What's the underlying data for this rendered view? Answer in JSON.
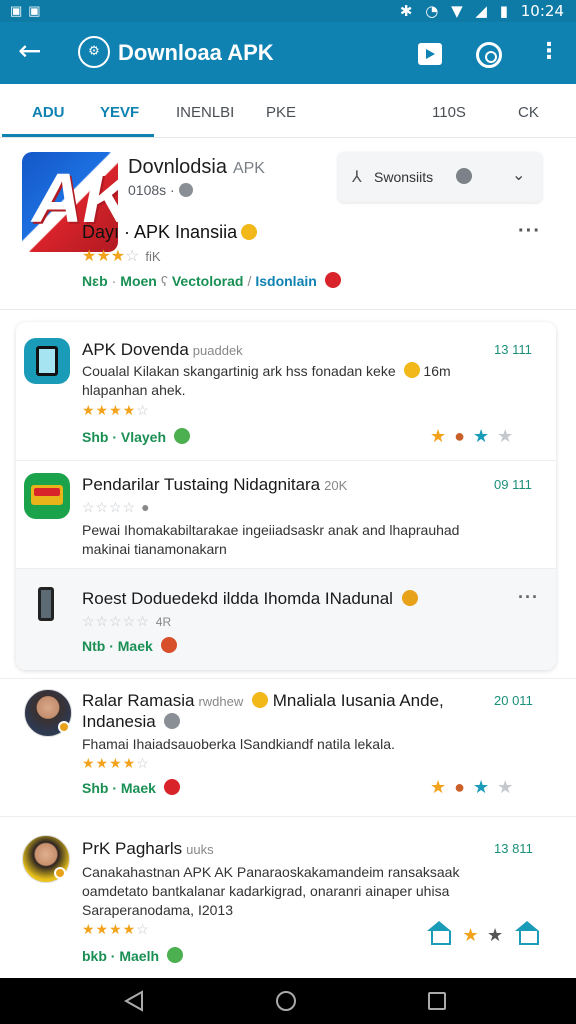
{
  "status_bar": {
    "time": "10:24"
  },
  "app_bar": {
    "title": "Downloaa APK"
  },
  "tabs": [
    {
      "label": "ADU",
      "active": true
    },
    {
      "label": "YEVF",
      "active": true
    },
    {
      "label": "INENLBI",
      "active": false
    },
    {
      "label": "PKE",
      "active": false
    },
    {
      "label": "110S",
      "active": false
    },
    {
      "label": "CK",
      "active": false
    }
  ],
  "header": {
    "title": "Dovnlodsia",
    "title_suffix": "APK",
    "subtitle": "0108s ·",
    "app_name": "Dayı · APK Inansiia",
    "rating_count": "fiK",
    "tags": {
      "t1": "Nɛb",
      "t2": "Moen",
      "t3": "Vectolorad",
      "t4": "Isdonlain"
    },
    "dropdown_label": "Swonsiits"
  },
  "items": [
    {
      "title": "APK Dovenda",
      "title_suffix": "puaddek",
      "desc_line1": "Coualal Kilakan skangartinig ark hss fonadan keke",
      "desc_line1_suffix": "16m",
      "desc_line2": "hlapanhan ahek.",
      "tags": "Shb · Vlayeh",
      "date": "13 111"
    },
    {
      "title": "Pendarilar Tustaing Nidagnitara",
      "title_suffix": "20K",
      "desc_line1": "Pewai Ihomakabiltarakae ingeiiadsaskr anak and lhaprauhad",
      "desc_line2": "makinai tianamonakarn",
      "tags": "",
      "date": "09 111"
    },
    {
      "title": "Roest Doduedekd ildda Ihomda INadunal",
      "title_suffix": "",
      "rating_count": "4R",
      "tags": "Ntb · Maek",
      "date": ""
    },
    {
      "title": "Ralar Ramasia",
      "title_suffix": "rwdhew",
      "title_tail": "Mnaliala Iusania Ande,",
      "title_line2": "Indanesia",
      "desc_line1": "Fhamai Ihaiadsauoberka lSandkiandf natila lekala.",
      "tags": "Shb · Maek",
      "date": "20 011"
    },
    {
      "title": "PrK Pagharls",
      "title_suffix": "uuks",
      "desc_line1": "Canakahastnan APK AK Panaraoskakamandeim ransaksaak",
      "desc_line2": "oamdetato bantkalanar kadarkigrad, onaranri ainaper uhisa",
      "desc_line3": "Saraperanodama, I2013",
      "tags": "bkb · Maelh",
      "date": "13 811"
    }
  ],
  "colors": {
    "app_bar": "#0f82b2",
    "status_bar": "#0e7aa6",
    "accent_green": "#1a8f54",
    "star": "#f2a31b"
  }
}
